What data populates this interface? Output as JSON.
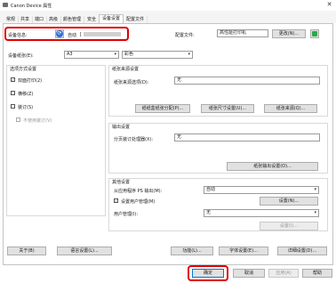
{
  "window": {
    "title": "Canon Device 属性"
  },
  "tabs": [
    "常规",
    "共享",
    "端口",
    "高级",
    "颜色管理",
    "安全",
    "设备设置",
    "配置文件"
  ],
  "active_tab": "设备设置",
  "device_info": {
    "label": "设备信息:",
    "auto_label": "自动",
    "auto_value": "[",
    "config_label": "配置文件:",
    "config_value": "高性能打印机",
    "change_button": "更改(N)..."
  },
  "paper": {
    "label": "设备纸张(E):",
    "size_value": "A3",
    "orientation_value": "彩色"
  },
  "options": {
    "title": "选项方式设置",
    "duplex": "双面打印(2)",
    "hole_punch": "横移(Z)",
    "staple": "装订(S)",
    "saddle": "不使用装订(V)"
  },
  "paper_source": {
    "title": "纸张来源设置",
    "source_label": "纸张来源选项(D):",
    "source_value": "无",
    "buttons": [
      "纸纸盒纸张分配(P)...",
      "纸张尺寸设置(U)...",
      "纸张来源(Q)..."
    ]
  },
  "output": {
    "title": "输出设置",
    "tray_label": "分页装订处理器(X):",
    "tray_value": "无",
    "button": "纸张输出设置(O)..."
  },
  "other": {
    "title": "其他设置",
    "ps_label": "从应用程序 PS 输出(M):",
    "ps_value": "自动",
    "user_mgmt_label": "设置用户管理(M)",
    "user_mgmt_btn": "设置(N)...",
    "user_auth_label": "用户管理(I):",
    "user_auth_value": "无",
    "auth_btn": "设置(I)..."
  },
  "footer_buttons": {
    "about": "关于(B)",
    "language": "语言设置(L)...",
    "features": "功能(L)...",
    "fonts": "字体设置(E)...",
    "details": "详细设置(D)..."
  },
  "dialog_buttons": {
    "ok": "确定",
    "cancel": "取消",
    "apply": "应用(A)",
    "help": "帮助"
  }
}
